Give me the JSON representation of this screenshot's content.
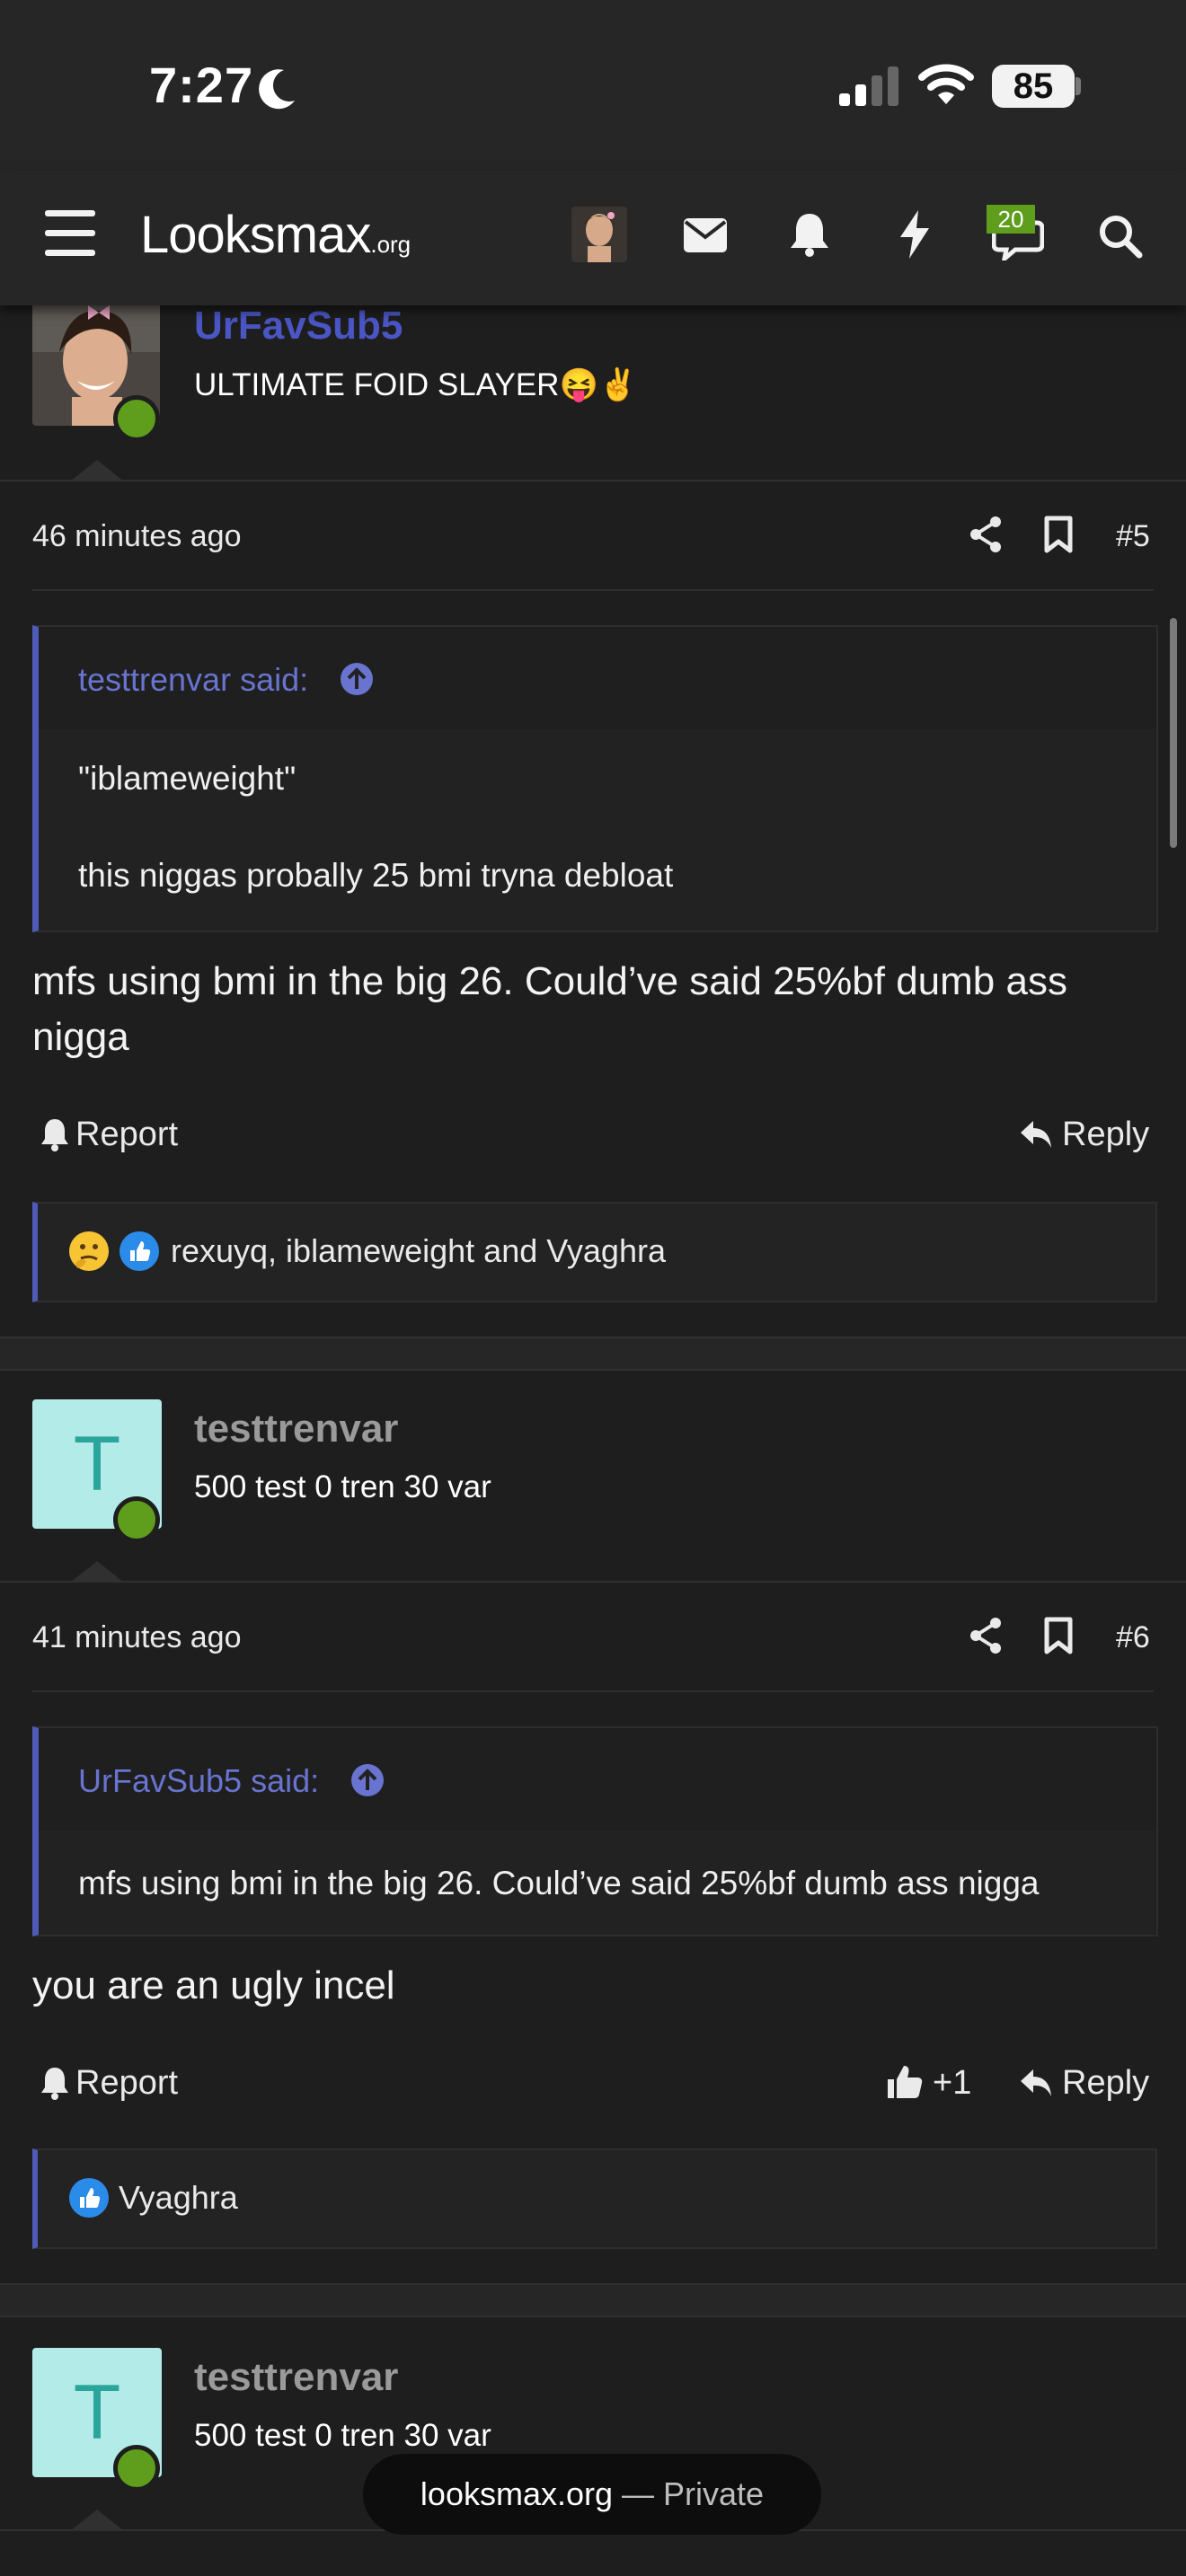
{
  "status_bar": {
    "time": "7:27",
    "battery": "85"
  },
  "header": {
    "logo_main": "Looksmax",
    "logo_suffix": ".org",
    "notification_badge": "20"
  },
  "posts": [
    {
      "username": "UrFavSub5",
      "user_title": "ULTIMATE FOID SLAYER😝✌️",
      "time": "46 minutes ago",
      "number": "#5",
      "quote_author": "testtrenvar said:",
      "quote_lines": [
        "\"iblameweight\"",
        "this niggas probally 25 bmi tryna debloat"
      ],
      "body_lines": [
        "mfs using bmi in the big 26. Could’ve said 25%bf dumb ass",
        "nigga"
      ],
      "report_label": "Report",
      "reply_label": "Reply",
      "reactions": "rexuyq, iblameweight and Vyaghra"
    },
    {
      "username": "testtrenvar",
      "avatar_letter": "T",
      "user_title": "500 test 0 tren 30 var",
      "time": "41 minutes ago",
      "number": "#6",
      "quote_author": "UrFavSub5 said:",
      "quote_lines": [
        "mfs using bmi in the big 26. Could’ve said 25%bf dumb ass nigga"
      ],
      "body_lines": [
        "you are an ugly incel"
      ],
      "report_label": "Report",
      "like_label": "+1",
      "reply_label": "Reply",
      "reactions": "Vyaghra"
    },
    {
      "username": "testtrenvar",
      "avatar_letter": "T",
      "user_title": "500 test 0 tren 30 var"
    }
  ],
  "browser": {
    "site": "looksmax.org",
    "mode": "— Private"
  },
  "colors": {
    "accent": "#4f5bb8",
    "online": "#5f9e1c",
    "username_blue": "#4a56c4",
    "username_gray": "#9a9a9a"
  },
  "icons": [
    "moon-icon",
    "signal-icon",
    "wifi-icon",
    "menu-icon",
    "mail-icon",
    "bell-icon",
    "bolt-icon",
    "chat-icon",
    "search-icon",
    "share-icon",
    "bookmark-icon",
    "arrow-up-circle-icon",
    "reply-icon",
    "thumbs-up-icon",
    "thinking-emoji-icon",
    "like-reaction-icon"
  ]
}
